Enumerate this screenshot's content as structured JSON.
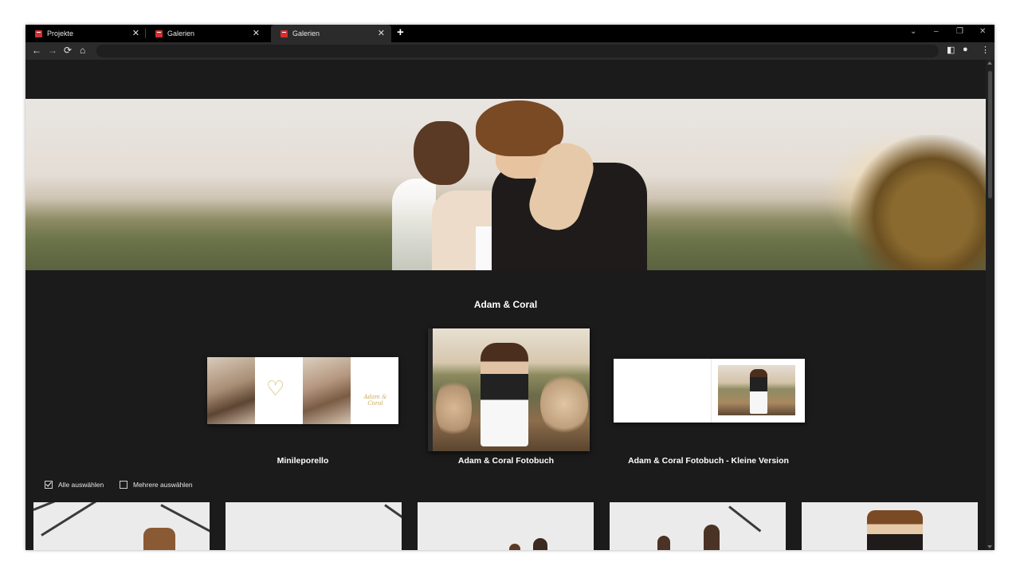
{
  "browser": {
    "tabs": [
      {
        "label": "Projekte",
        "active": false
      },
      {
        "label": "Galerien",
        "active": false
      },
      {
        "label": "Galerien",
        "active": true
      }
    ],
    "new_tab": "+",
    "close_glyph": "✕",
    "nav": {
      "back": "←",
      "forward": "→",
      "reload": "⟳",
      "home": "⌂"
    },
    "window_controls": {
      "dropdown": "⌄",
      "minimize": "–",
      "restore": "❐",
      "close": "✕"
    },
    "toolbar_icons": {
      "sidepanel": "◧",
      "profile": "●",
      "menu": "⋮"
    },
    "omnibox_value": ""
  },
  "gallery": {
    "title": "Adam & Coral",
    "products": [
      {
        "label": "Minileporello"
      },
      {
        "label": "Adam & Coral Fotobuch"
      },
      {
        "label": "Adam & Coral Fotobuch - Kleine Version"
      }
    ],
    "minileporello_script": "Adam & Coral",
    "select_all_label": "Alle auswählen",
    "select_all_checked": true,
    "select_multiple_label": "Mehrere auswählen",
    "select_multiple_checked": false
  },
  "colors": {
    "page_bg": "#1b1b1b",
    "tab_bar": "#000000",
    "favicon": "#d32f2f",
    "accent_gold": "#d4b96d"
  }
}
